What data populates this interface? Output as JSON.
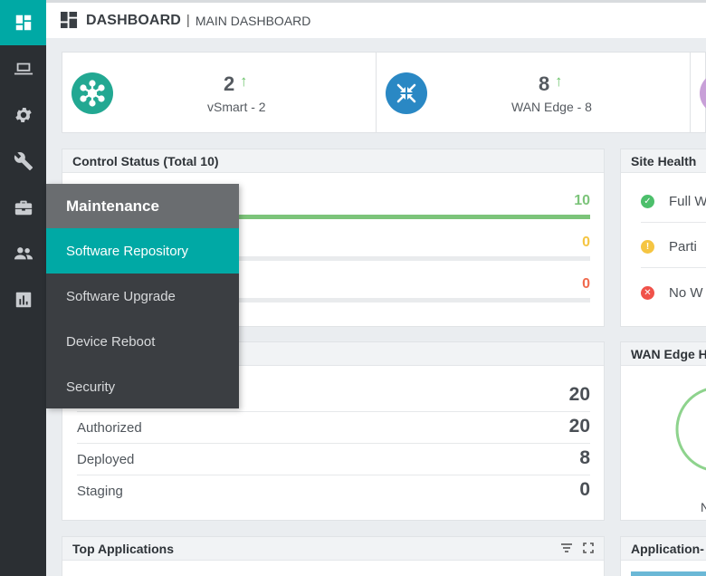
{
  "header": {
    "title": "DASHBOARD",
    "separator": "|",
    "subtitle": "MAIN DASHBOARD"
  },
  "sidebar": {
    "items": [
      {
        "icon": "dashboard-icon",
        "active": true
      },
      {
        "icon": "laptop-icon",
        "active": false
      },
      {
        "icon": "gear-icon",
        "active": false
      },
      {
        "icon": "wrench-icon",
        "active": false
      },
      {
        "icon": "briefcase-icon",
        "active": false
      },
      {
        "icon": "users-icon",
        "active": false
      },
      {
        "icon": "bar-chart-icon",
        "active": false
      }
    ]
  },
  "stats": [
    {
      "count": "2",
      "arrow": "↑",
      "label": "vSmart - 2",
      "icon": "network-hub-icon",
      "color": "#1fa896"
    },
    {
      "count": "8",
      "arrow": "↑",
      "label": "WAN Edge - 8",
      "icon": "expand-arrows-icon",
      "color": "#2a88c4"
    },
    {
      "icon": "device-icon",
      "color": "#c8a0d8"
    }
  ],
  "control_status": {
    "title": "Control Status (Total 10)",
    "rows": [
      {
        "value": "10",
        "color": "#7cc47a",
        "fraction": 1.0
      },
      {
        "value": "0",
        "color": "#f5c542",
        "fraction": 0
      },
      {
        "value": "0",
        "color": "#f06a4e",
        "fraction": 0
      }
    ]
  },
  "site_health": {
    "title": "Site Health",
    "rows": [
      {
        "text": "Full W",
        "icon": "check-circle-icon",
        "color": "#4cbf6b",
        "glyph": "✓"
      },
      {
        "text": "Parti",
        "icon": "warning-circle-icon",
        "color": "#f5c542",
        "glyph": "!"
      },
      {
        "text": "No W",
        "icon": "error-circle-icon",
        "color": "#f0524a",
        "glyph": "✕"
      }
    ]
  },
  "inventory": {
    "rows": [
      {
        "label": "",
        "value": "20"
      },
      {
        "label": "Authorized",
        "value": "20"
      },
      {
        "label": "Deployed",
        "value": "8"
      },
      {
        "label": "Staging",
        "value": "0"
      }
    ]
  },
  "wan_edge_health": {
    "title": "WAN Edge H",
    "caption": "N"
  },
  "top_applications": {
    "title": "Top Applications"
  },
  "application_panel": {
    "title": "Application-"
  },
  "flyout": {
    "title": "Maintenance",
    "items": [
      {
        "label": "Software Repository",
        "active": true
      },
      {
        "label": "Software Upgrade",
        "active": false
      },
      {
        "label": "Device Reboot",
        "active": false
      },
      {
        "label": "Security",
        "active": false
      }
    ]
  }
}
